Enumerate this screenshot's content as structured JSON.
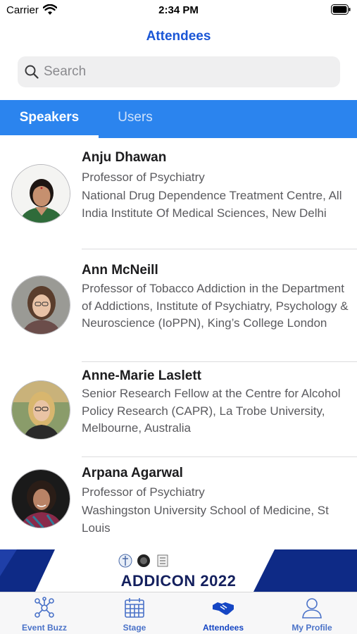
{
  "status_bar": {
    "carrier": "Carrier",
    "time": "2:34 PM"
  },
  "nav": {
    "title": "Attendees"
  },
  "search": {
    "placeholder": "Search",
    "value": ""
  },
  "tabs": [
    {
      "label": "Speakers",
      "selected": true
    },
    {
      "label": "Users",
      "selected": false
    }
  ],
  "speakers": [
    {
      "name": "Anju Dhawan",
      "role": "Professor of Psychiatry",
      "organization": "National Drug Dependence Treatment Centre, All India Institute Of Medical Sciences, New Delhi"
    },
    {
      "name": "Ann McNeill",
      "role": "Professor of Tobacco Addiction in the Department of Addictions, Institute of Psychiatry, Psychology & Neuroscience (IoPPN), King’s College London"
    },
    {
      "name": "Anne-Marie Laslett",
      "role": "Senior Research Fellow at the Centre for Alcohol Policy Research (CAPR), La Trobe University, Melbourne, Australia"
    },
    {
      "name": "Arpana Agarwal",
      "role": "Professor of Psychiatry",
      "organization": "Washingston University School of Medicine, St Louis"
    }
  ],
  "banner": {
    "title": "ADDICON 2022"
  },
  "bottom_nav": [
    {
      "label": "Event Buzz",
      "icon": "network-icon"
    },
    {
      "label": "Stage",
      "icon": "calendar-icon"
    },
    {
      "label": "Attendees",
      "icon": "handshake-icon",
      "selected": true
    },
    {
      "label": "My Profile",
      "icon": "person-icon"
    }
  ],
  "colors": {
    "accent": "#1a56d6",
    "tab_bar": "#2b84ee",
    "banner_navy": "#0e2a86"
  }
}
